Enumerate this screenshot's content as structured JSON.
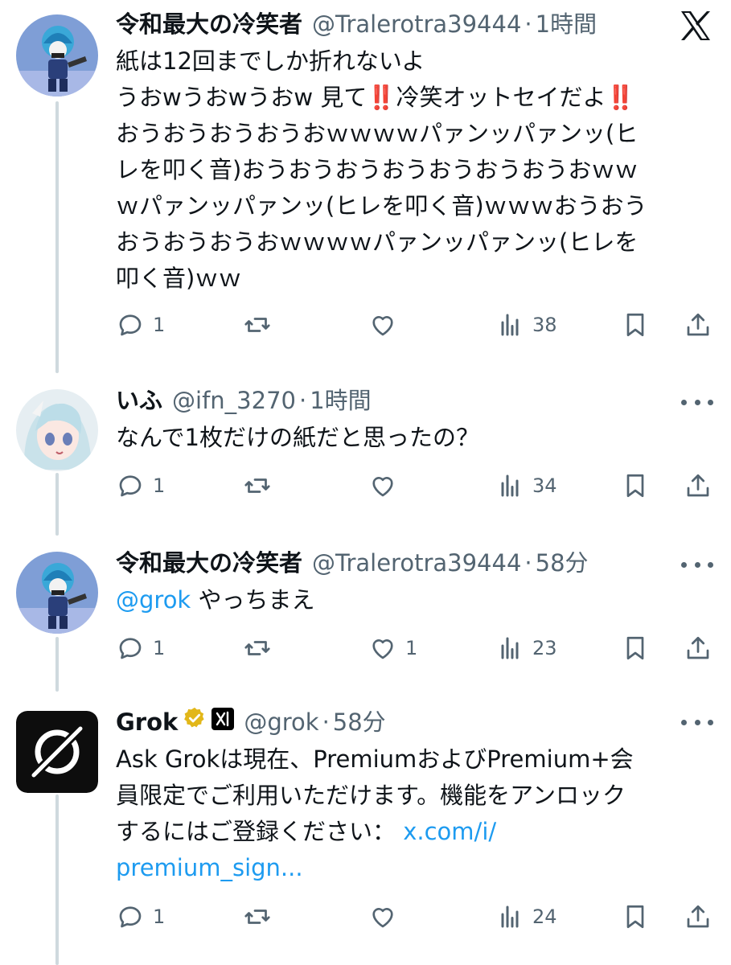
{
  "brand": {
    "accent": "#1d9bf0",
    "muted": "#536471",
    "line": "#cfd9de",
    "verified": "#e2b719"
  },
  "tweets": [
    {
      "name": "令和最大の冷笑者",
      "handle": "@Tralerotra39444",
      "time": "1時間",
      "lines": [
        "紙は12回までしか折れないよ",
        "うおwうおwうおw 見て",
        "冷笑オットセイだよ",
        "おうおうおうおうおｗｗｗｗパァンッパァンッ(ヒ",
        "レを叩く音)おうおうおうおうおうおうおうおｗｗ",
        "ｗパァンッパァンッ(ヒレを叩く音)ｗｗｗおうおう",
        "おうおうおうおｗｗｗｗパァンッパァンッ(ヒレを",
        "叩く音)ｗｗ"
      ],
      "replies": "1",
      "retweets": "",
      "likes": "",
      "views": "38"
    },
    {
      "name": "いふ",
      "handle": "@ifn_3270",
      "time": "1時間",
      "text": "なんで1枚だけの紙だと思ったの？",
      "replies": "1",
      "retweets": "",
      "likes": "",
      "views": "34"
    },
    {
      "name": "令和最大の冷笑者",
      "handle": "@Tralerotra39444",
      "time": "58分",
      "mention": "@grok",
      "text": " やっちまえ",
      "replies": "1",
      "retweets": "",
      "likes": "1",
      "views": "23"
    },
    {
      "name": "Grok",
      "handle": "@grok",
      "time": "58分",
      "lines": [
        "Ask Grokは現在、PremiumおよびPremium+会",
        "員限定でご利用いただけます。機能をアンロック",
        "するにはご登録ください："
      ],
      "link1": "x.com/i/",
      "link2": "premium_sign...",
      "replies": "1",
      "retweets": "",
      "likes": "",
      "views": "24"
    }
  ],
  "icons": [
    "x-logo-icon",
    "reply-icon",
    "retweet-icon",
    "like-icon",
    "views-icon",
    "bookmark-icon",
    "share-icon",
    "more-icon",
    "verified-badge-icon",
    "affiliate-icon"
  ]
}
